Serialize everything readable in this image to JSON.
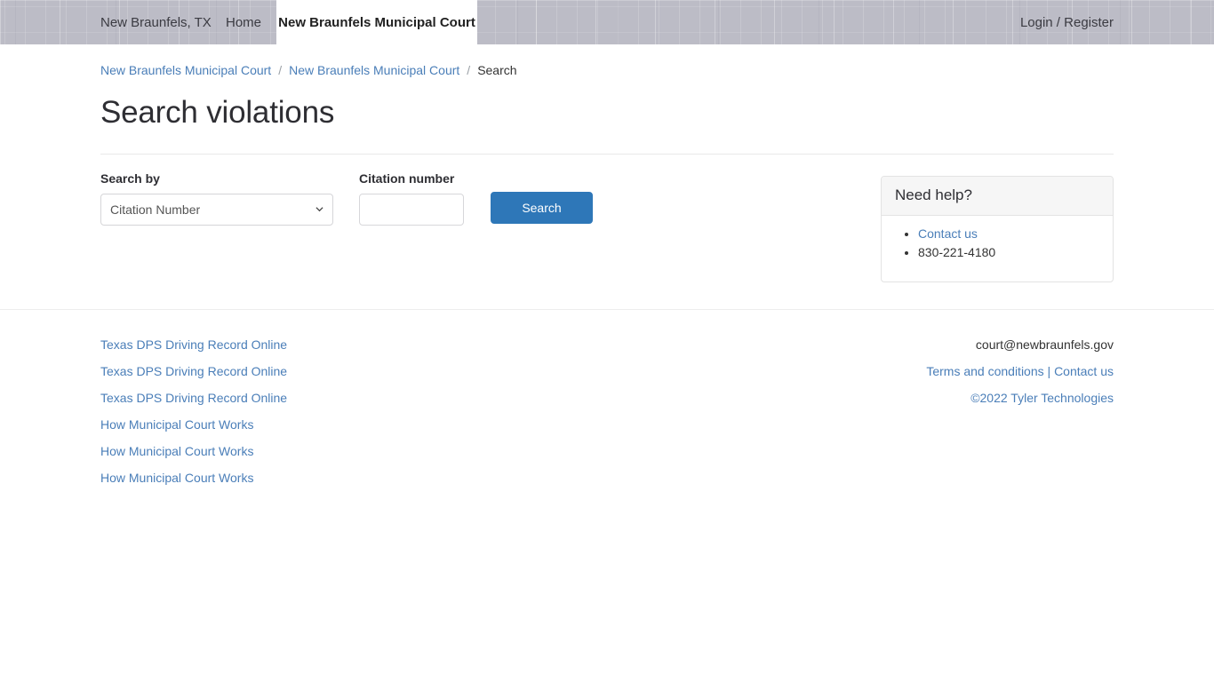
{
  "topnav": {
    "city_link": "New Braunfels, TX",
    "home_link": "Home",
    "active_tab": "New Braunfels Municipal Court",
    "login_link": "Login / Register"
  },
  "breadcrumb": {
    "item1": "New Braunfels Municipal Court",
    "item2": "New Braunfels Municipal Court",
    "current": "Search",
    "separator": "/"
  },
  "page": {
    "title": "Search violations"
  },
  "form": {
    "search_by_label": "Search by",
    "search_by_value": "Citation Number",
    "search_by_options": [
      "Citation Number"
    ],
    "citation_label": "Citation number",
    "citation_value": "",
    "citation_placeholder": "",
    "search_button": "Search"
  },
  "help": {
    "title": "Need help?",
    "contact_link": "Contact us",
    "phone": "830-221-4180"
  },
  "footer": {
    "links": [
      "Texas DPS Driving Record Online",
      "Texas DPS Driving Record Online",
      "Texas DPS Driving Record Online",
      "How Municipal Court Works",
      "How Municipal Court Works",
      "How Municipal Court Works"
    ],
    "email": "court@newbraunfels.gov",
    "terms_link": "Terms and conditions",
    "pipe": "|",
    "contact_link": "Contact us",
    "copyright": "©2022 Tyler Technologies"
  },
  "colors": {
    "link": "#4a7eb8",
    "button": "#2e77b8",
    "nav_background": "#bcbcc6"
  }
}
